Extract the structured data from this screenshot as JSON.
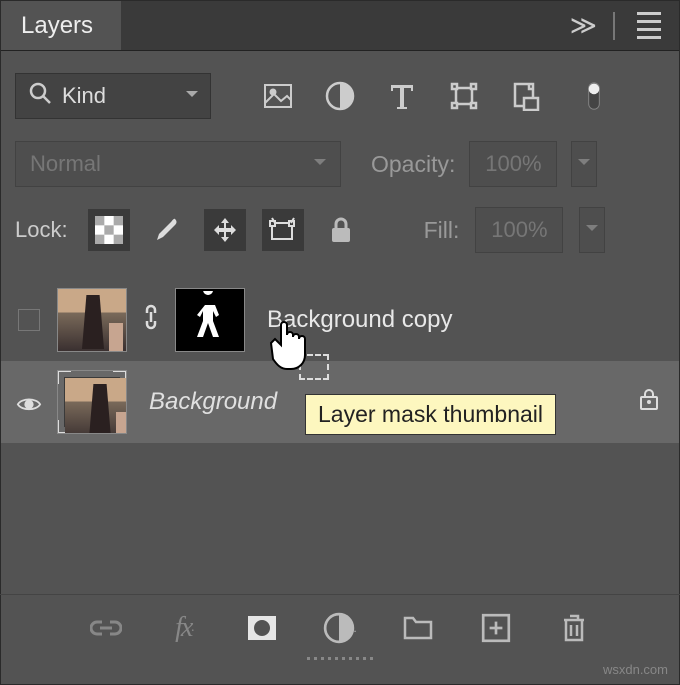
{
  "panel": {
    "title": "Layers"
  },
  "filter": {
    "label": "Kind",
    "icons": [
      "pixel-layer",
      "adjustment-layer",
      "type-layer",
      "shape-layer",
      "smart-object"
    ]
  },
  "blend": {
    "mode": "Normal",
    "opacity_label": "Opacity:",
    "opacity_value": "100%"
  },
  "lock": {
    "label": "Lock:",
    "fill_label": "Fill:",
    "fill_value": "100%"
  },
  "layers": [
    {
      "name": "Background copy",
      "selected": true,
      "visible": false,
      "hasMask": true,
      "locked": false
    },
    {
      "name": "Background",
      "selected": false,
      "visible": true,
      "hasMask": false,
      "locked": true
    }
  ],
  "tooltip": "Layer mask thumbnail",
  "watermark": "wsxdn.com"
}
